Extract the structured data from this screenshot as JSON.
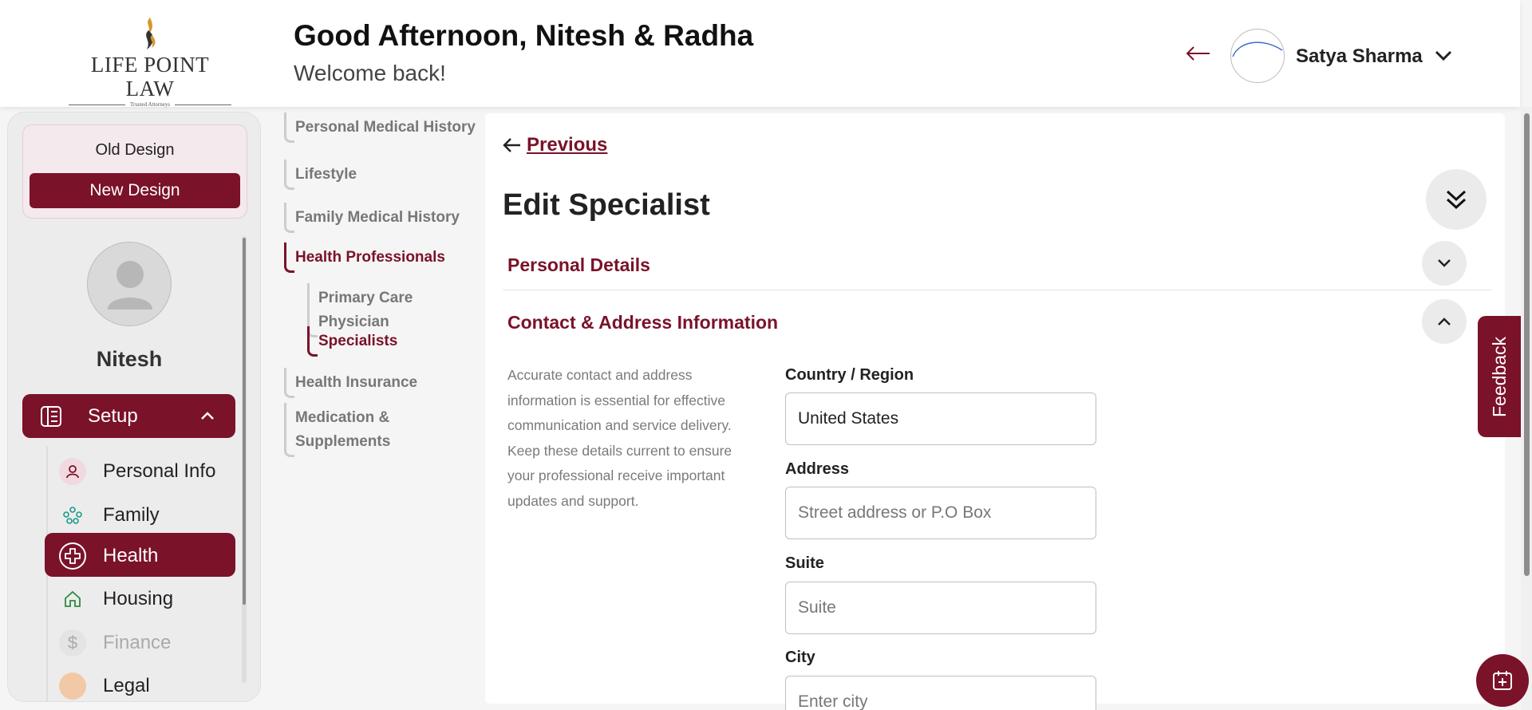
{
  "header": {
    "logo_text": "LIFE POINT LAW",
    "logo_tagline": "Trusted Attorneys",
    "greeting": "Good Afternoon, Nitesh & Radha",
    "subtitle": "Welcome back!",
    "user_name": "Satya Sharma"
  },
  "sidebar": {
    "old_design_label": "Old Design",
    "new_design_label": "New Design",
    "profile_name": "Nitesh",
    "setup_label": "Setup",
    "items": [
      {
        "label": "Personal Info",
        "icon": "person-icon",
        "state": "normal"
      },
      {
        "label": "Family",
        "icon": "family-icon",
        "state": "normal"
      },
      {
        "label": "Health",
        "icon": "health-plus-icon",
        "state": "active"
      },
      {
        "label": "Housing",
        "icon": "house-icon",
        "state": "normal"
      },
      {
        "label": "Finance",
        "icon": "dollar-icon",
        "state": "disabled"
      },
      {
        "label": "Legal",
        "icon": "legal-icon",
        "state": "normal"
      }
    ]
  },
  "stepper": {
    "steps": [
      {
        "label": "Personal Medical History",
        "state": "normal"
      },
      {
        "label": "Lifestyle",
        "state": "normal"
      },
      {
        "label": "Family Medical History",
        "state": "normal"
      },
      {
        "label": "Health Professionals",
        "state": "active"
      },
      {
        "label": "Primary Care Physician",
        "state": "normal"
      },
      {
        "label": "Specialists",
        "state": "active"
      },
      {
        "label": "Health Insurance",
        "state": "normal"
      },
      {
        "label": "Medication & Supplements",
        "state": "normal"
      }
    ]
  },
  "main": {
    "previous_label": "Previous",
    "title": "Edit Specialist",
    "sections": {
      "personal": "Personal Details",
      "contact": "Contact & Address Information"
    },
    "contact_description": "Accurate contact and address information is essential for effective communication and service delivery. Keep these details current to ensure your professional receive important updates and support.",
    "fields": {
      "country": {
        "label": "Country / Region",
        "value": "United States"
      },
      "address": {
        "label": "Address",
        "placeholder": "Street address or P.O Box"
      },
      "suite": {
        "label": "Suite",
        "placeholder": "Suite"
      },
      "city": {
        "label": "City",
        "placeholder": "Enter city"
      }
    }
  },
  "feedback_label": "Feedback",
  "colors": {
    "brand": "#7a1229",
    "background": "#f5f5f5",
    "panel": "#ffffff"
  }
}
